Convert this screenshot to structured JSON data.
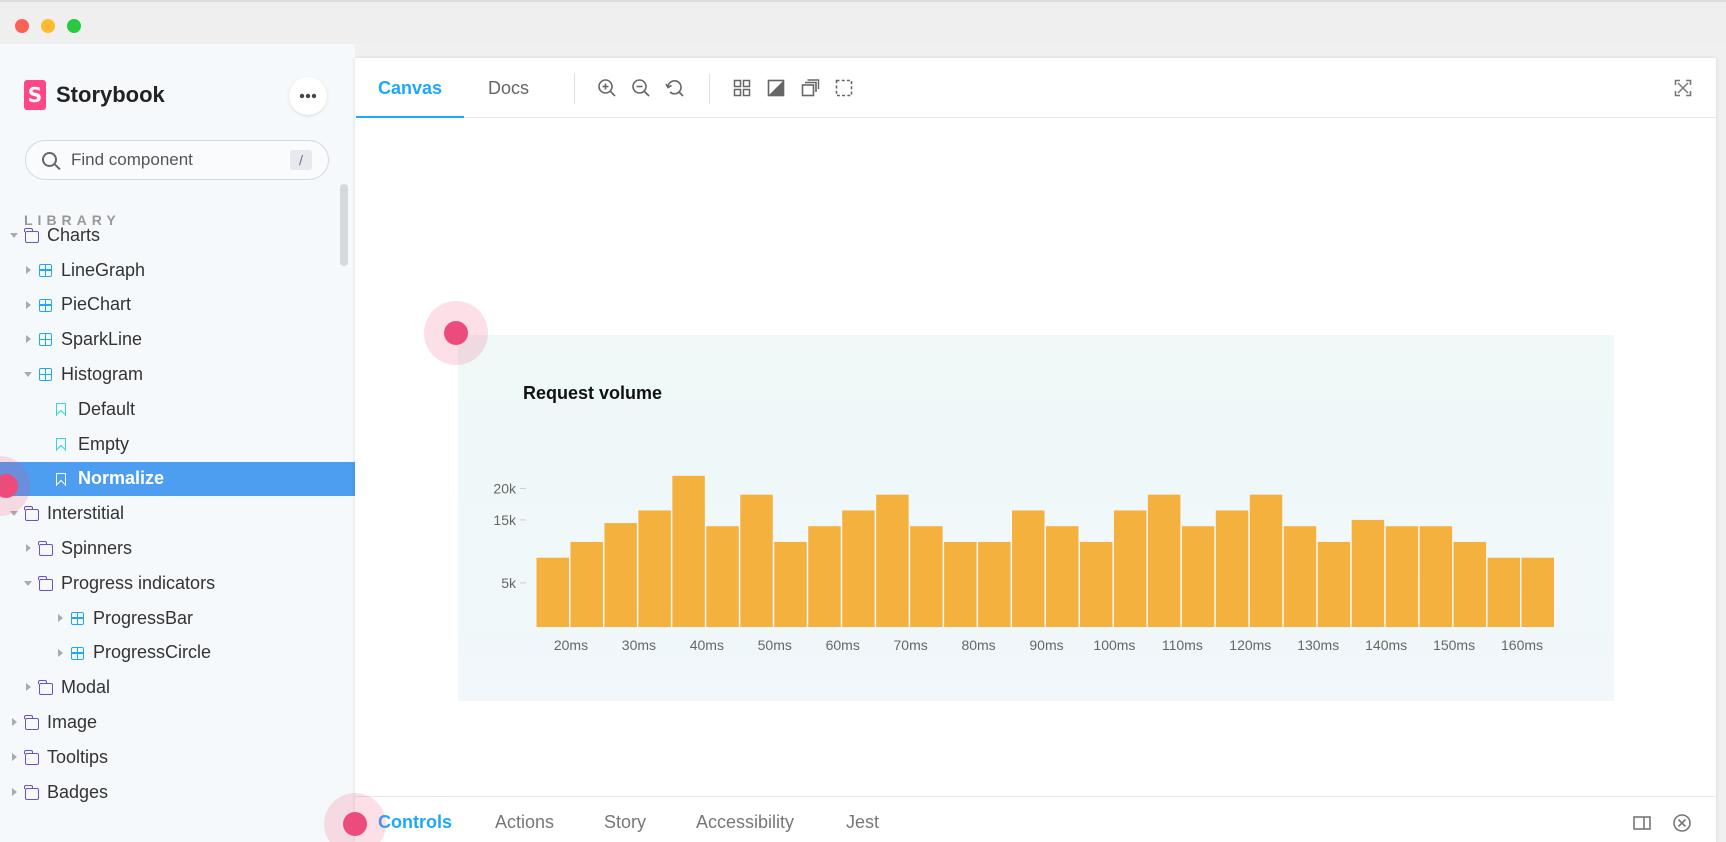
{
  "sidebar": {
    "brand": "Storybook",
    "brand_logo_letter": "S",
    "more_icon": "more-horizontal-icon",
    "search": {
      "placeholder": "Find component",
      "shortcut": "/"
    },
    "library_label": "LIBRARY",
    "tree": [
      {
        "label": "Charts",
        "type": "folder",
        "level": 0,
        "expanded": true
      },
      {
        "label": "LineGraph",
        "type": "component",
        "level": 1,
        "expanded": false
      },
      {
        "label": "PieChart",
        "type": "component",
        "level": 1,
        "expanded": false
      },
      {
        "label": "SparkLine",
        "type": "component",
        "level": 1,
        "expanded": false
      },
      {
        "label": "Histogram",
        "type": "component",
        "level": 1,
        "expanded": true
      },
      {
        "label": "Default",
        "type": "story",
        "level": 2
      },
      {
        "label": "Empty",
        "type": "story",
        "level": 2
      },
      {
        "label": "Normalize",
        "type": "story",
        "level": 2,
        "selected": true
      },
      {
        "label": "Interstitial",
        "type": "folder",
        "level": 0,
        "expanded": true
      },
      {
        "label": "Spinners",
        "type": "folder",
        "level": 1,
        "expanded": false
      },
      {
        "label": "Progress indicators",
        "type": "folder",
        "level": 1,
        "expanded": true
      },
      {
        "label": "ProgressBar",
        "type": "component",
        "level": 2,
        "expanded": false
      },
      {
        "label": "ProgressCircle",
        "type": "component",
        "level": 2,
        "expanded": false
      },
      {
        "label": "Modal",
        "type": "folder",
        "level": 1,
        "expanded": false
      },
      {
        "label": "Image",
        "type": "folder",
        "level": 0,
        "expanded": false
      },
      {
        "label": "Tooltips",
        "type": "folder",
        "level": 0,
        "expanded": false
      },
      {
        "label": "Badges",
        "type": "folder",
        "level": 0,
        "expanded": false
      }
    ]
  },
  "toolbar": {
    "tabs": [
      {
        "label": "Canvas",
        "active": true
      },
      {
        "label": "Docs",
        "active": false
      }
    ],
    "tools": [
      "zoom-in-icon",
      "zoom-out-icon",
      "reset-zoom-icon",
      "grid-icon",
      "background-icon",
      "viewport-icon",
      "outline-icon"
    ],
    "fullscreen_icon": "fullscreen-icon"
  },
  "addons": {
    "tabs": [
      {
        "label": "Controls",
        "active": true
      },
      {
        "label": "Actions",
        "active": false
      },
      {
        "label": "Story",
        "active": false
      },
      {
        "label": "Accessibility",
        "active": false
      },
      {
        "label": "Jest",
        "active": false
      }
    ],
    "panel_icon": "panel-toggle-icon",
    "close_icon": "close-icon"
  },
  "colors": {
    "accent": "#1ea7fd",
    "selected_bg": "#4d9df0",
    "bar": "#f4b13e",
    "brand": "#ff4785",
    "hotspot": "#ec4c7b"
  },
  "chart_data": {
    "type": "bar",
    "title": "Request volume",
    "xlabel": "",
    "ylabel": "",
    "x_tick_labels": [
      "20ms",
      "30ms",
      "40ms",
      "50ms",
      "60ms",
      "70ms",
      "80ms",
      "90ms",
      "100ms",
      "110ms",
      "120ms",
      "130ms",
      "140ms",
      "150ms",
      "160ms"
    ],
    "y_tick_labels": [
      "5k",
      "15k",
      "20k"
    ],
    "y_ticks": [
      5000,
      15000,
      20000
    ],
    "ylim": [
      0,
      20000
    ],
    "values": [
      9000,
      11500,
      14500,
      16500,
      22000,
      14000,
      19000,
      11500,
      14000,
      16500,
      19000,
      14000,
      11500,
      11500,
      16500,
      14000,
      11500,
      16500,
      19000,
      14000,
      16500,
      19000,
      14000,
      11500,
      15000,
      14000,
      14000,
      11500,
      9000,
      9000
    ],
    "grid": false,
    "legend": "none"
  }
}
